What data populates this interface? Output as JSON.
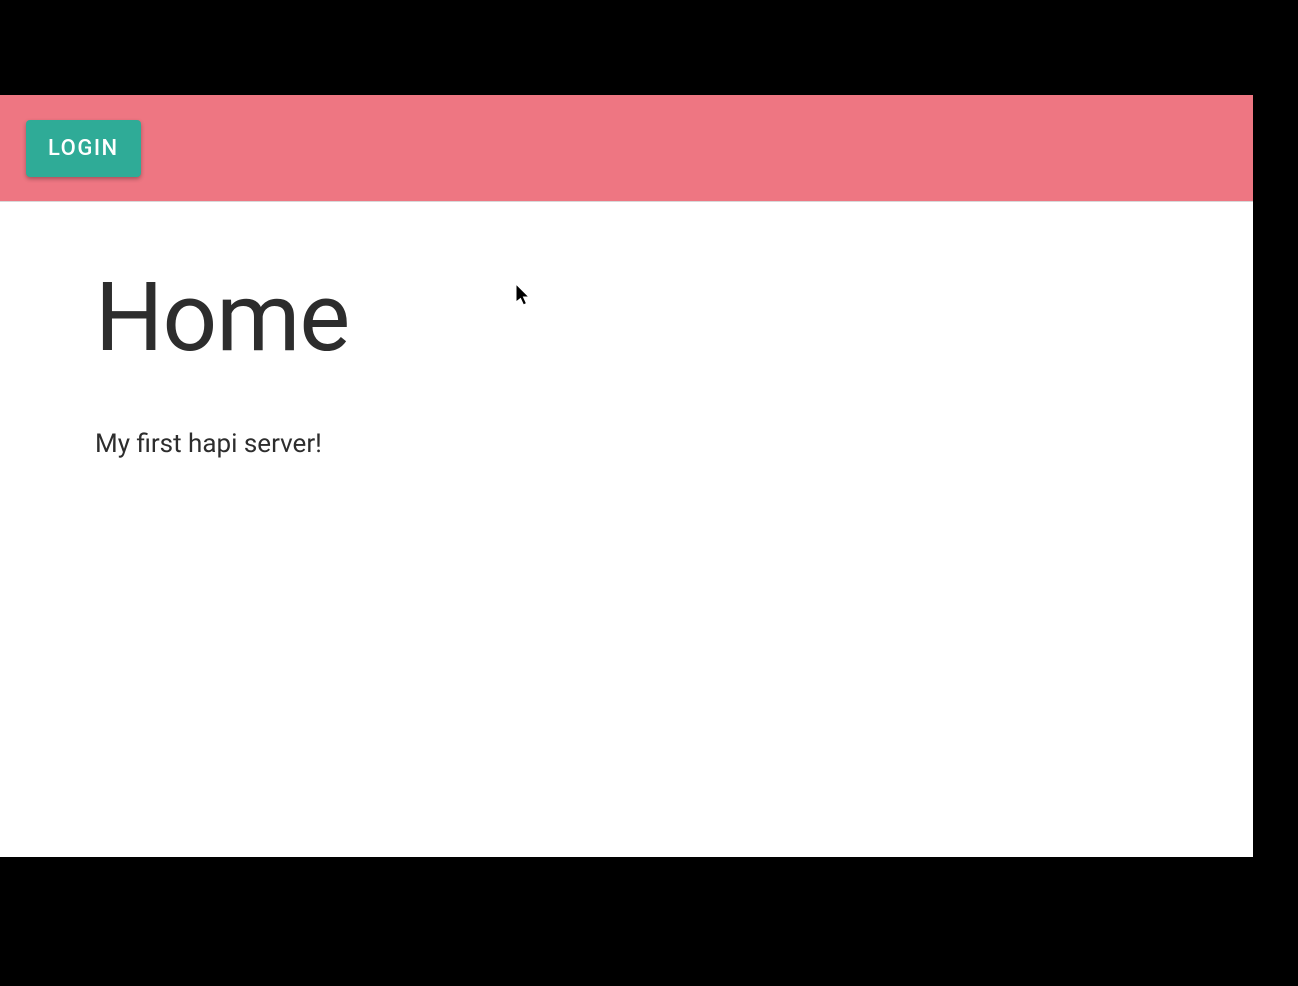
{
  "header": {
    "login_label": "LOGIN"
  },
  "main": {
    "title": "Home",
    "body_text": "My first hapi server!"
  },
  "colors": {
    "header_bg": "#ee7682",
    "button_bg": "#2fab97",
    "button_text": "#ffffff",
    "page_bg": "#ffffff",
    "outer_bg": "#000000",
    "text_color": "#2d2d2d"
  }
}
